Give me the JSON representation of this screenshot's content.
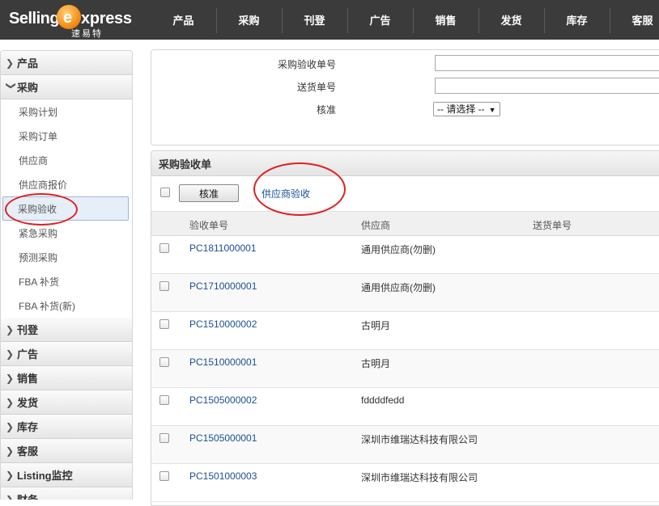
{
  "brand": {
    "word1": "Selling",
    "word2": "xpress",
    "sub": "速易特"
  },
  "nav": [
    "产品",
    "采购",
    "刊登",
    "广告",
    "销售",
    "发货",
    "库存",
    "客服"
  ],
  "sidebar": {
    "groups_top": [
      {
        "label": "产品",
        "expanded": false
      },
      {
        "label": "采购",
        "expanded": true
      }
    ],
    "sub_items": [
      "采购计划",
      "采购订单",
      "供应商",
      "供应商报价",
      "采购验收",
      "紧急采购",
      "预测采购",
      "FBA 补货",
      "FBA 补货(新)"
    ],
    "active_sub": "采购验收",
    "groups_bottom": [
      "刊登",
      "广告",
      "销售",
      "发货",
      "库存",
      "客服",
      "Listing监控",
      "财务"
    ]
  },
  "filter": {
    "receipt_no_label": "采购验收单号",
    "receipt_no_value": "",
    "delivery_no_label": "送货单号",
    "delivery_no_value": "",
    "approve_label": "核准",
    "approve_select": "-- 请选择 --"
  },
  "panel": {
    "title": "采购验收单",
    "approve_button": "核准",
    "supplier_link": "供应商验收",
    "columns": [
      "验收单号",
      "供应商",
      "送货单号"
    ],
    "rows": [
      {
        "no": "PC1811000001",
        "supplier": "通用供应商(勿删)",
        "delivery": ""
      },
      {
        "no": "PC1710000001",
        "supplier": "通用供应商(勿删)",
        "delivery": ""
      },
      {
        "no": "PC1510000002",
        "supplier": "古明月",
        "delivery": ""
      },
      {
        "no": "PC1510000001",
        "supplier": "古明月",
        "delivery": ""
      },
      {
        "no": "PC1505000002",
        "supplier": "fddddfedd",
        "delivery": ""
      },
      {
        "no": "PC1505000001",
        "supplier": "深圳市维瑞达科技有限公司",
        "delivery": ""
      },
      {
        "no": "PC1501000003",
        "supplier": "深圳市维瑞达科技有限公司",
        "delivery": ""
      }
    ]
  },
  "colors": {
    "topbar": "#3b3b3b",
    "link": "#1a4f9a",
    "highlight_circle": "#e02020",
    "logo_accent": "#f7941d"
  }
}
